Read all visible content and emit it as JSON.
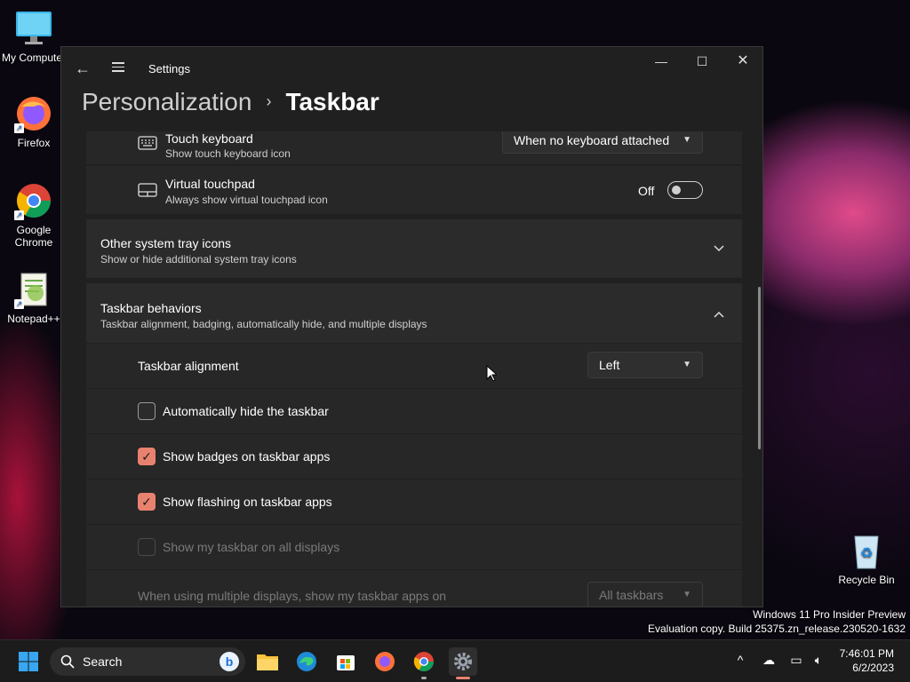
{
  "desktop": {
    "icons": [
      {
        "label": "My Computer"
      },
      {
        "label": "Firefox"
      },
      {
        "label": "Google Chrome"
      },
      {
        "label": "Notepad++"
      },
      {
        "label": "Recycle Bin"
      }
    ],
    "watermark": {
      "line1": "Windows 11 Pro Insider Preview",
      "line2": "Evaluation copy. Build 25375.zn_release.230520-1632"
    }
  },
  "window": {
    "app_title": "Settings",
    "breadcrumb": {
      "parent": "Personalization",
      "separator": "›",
      "current": "Taskbar"
    },
    "controls": {
      "minimize": "—",
      "maximize": "☐",
      "close": "✕"
    }
  },
  "settings": {
    "touch_keyboard": {
      "title": "Touch keyboard",
      "desc": "Show touch keyboard icon",
      "value": "When no keyboard attached"
    },
    "virtual_touchpad": {
      "title": "Virtual touchpad",
      "desc": "Always show virtual touchpad icon",
      "state": "Off"
    },
    "other_tray": {
      "title": "Other system tray icons",
      "desc": "Show or hide additional system tray icons"
    },
    "behaviors": {
      "title": "Taskbar behaviors",
      "desc": "Taskbar alignment, badging, automatically hide, and multiple displays"
    },
    "alignment": {
      "label": "Taskbar alignment",
      "value": "Left"
    },
    "auto_hide": {
      "label": "Automatically hide the taskbar",
      "checked": false
    },
    "badges": {
      "label": "Show badges on taskbar apps",
      "checked": true
    },
    "flashing": {
      "label": "Show flashing on taskbar apps",
      "checked": true
    },
    "all_displays": {
      "label": "Show my taskbar on all displays",
      "checked": false,
      "disabled": true
    },
    "multi_display": {
      "label": "When using multiple displays, show my taskbar apps on",
      "value": "All taskbars",
      "disabled": true
    }
  },
  "taskbar": {
    "search_label": "Search",
    "clock": {
      "time": "7:46:01 PM",
      "date": "6/2/2023"
    }
  },
  "colors": {
    "accent": "#e8826f",
    "window_bg": "#202020",
    "card_bg": "#2b2b2b"
  }
}
